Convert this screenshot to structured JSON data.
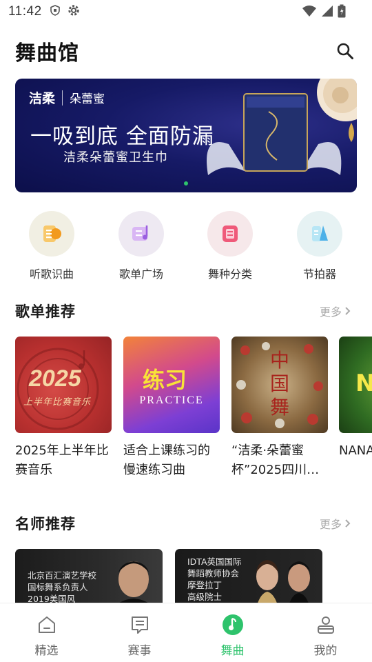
{
  "status": {
    "time": "11:42"
  },
  "header": {
    "title": "舞曲馆"
  },
  "banner": {
    "brand": "洁柔",
    "brand2": "朵蕾蜜",
    "headline": "一吸到底 全面防漏",
    "sub": "洁柔朵蕾蜜卫生巾",
    "active_color": "#2ec36c"
  },
  "quick": [
    {
      "label": "听歌识曲",
      "icon": "recognize-music-icon",
      "bg": "#f1efe3",
      "color": "#f4b23c"
    },
    {
      "label": "歌单广场",
      "icon": "playlist-square-icon",
      "bg": "#eee9f2",
      "color": "#b07ee6"
    },
    {
      "label": "舞种分类",
      "icon": "dance-category-icon",
      "bg": "#f6e8ea",
      "color": "#ef5a7a"
    },
    {
      "label": "节拍器",
      "icon": "metronome-icon",
      "bg": "#e6f2f3",
      "color": "#4db1e8"
    }
  ],
  "playlist_section": {
    "title": "歌单推荐",
    "more": "更多"
  },
  "playlists": [
    {
      "title": "2025年上半年比赛音乐",
      "cover_text": "2025",
      "cover_sub": "上半年比赛音乐"
    },
    {
      "title": "适合上课练习的慢速练习曲",
      "cover_text": "练习",
      "cover_sub": "PRACTICE"
    },
    {
      "title": "“洁柔·朵蕾蜜杯”2025四川…",
      "cover_text": "中国舞"
    },
    {
      "title": "NANA赛音乐",
      "cover_text": "N"
    }
  ],
  "teacher_section": {
    "title": "名师推荐",
    "more": "更多"
  },
  "teachers": [
    {
      "line1": "北京百汇演艺学校",
      "line2": "国标舞系负责人",
      "line3": "2019美国风"
    },
    {
      "line1": "IDTA英国国际",
      "line2": "舞蹈教师协会",
      "line3": "摩登拉丁",
      "line4": "高级院士"
    }
  ],
  "nav": [
    {
      "label": "精选",
      "icon": "home-icon"
    },
    {
      "label": "赛事",
      "icon": "events-icon"
    },
    {
      "label": "舞曲",
      "icon": "music-note-icon",
      "active": true
    },
    {
      "label": "我的",
      "icon": "profile-icon"
    }
  ],
  "colors": {
    "accent": "#2ec36c",
    "muted": "#aaaaaa"
  }
}
